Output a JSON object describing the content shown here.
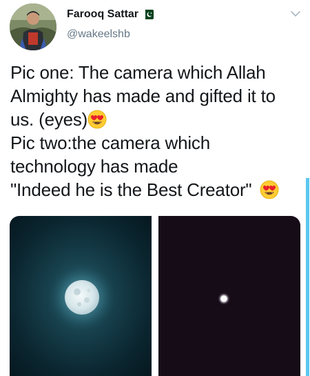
{
  "author": {
    "display_name": "Farooq Sattar",
    "handle": "@wakeelshb",
    "verified_flag_icon": "pakistan-flag-icon"
  },
  "tweet": {
    "lines": [
      "Pic one: The camera which Allah",
      "Almighty has made and gifted it to",
      "us. (eyes)",
      "Pic two:the camera which",
      "technology has made",
      "\"Indeed he is the Best Creator\""
    ],
    "emoji": "heart-eyes-emoji"
  },
  "media": {
    "photos": [
      {
        "subject": "full-moon-photo"
      },
      {
        "subject": "night-sky-moon-dot-photo"
      }
    ]
  },
  "colors": {
    "name": "#14171a",
    "handle": "#657786",
    "accent": "#5bc8f0",
    "flag_green": "#01411c"
  },
  "menu_icon": "chevron-down-icon"
}
